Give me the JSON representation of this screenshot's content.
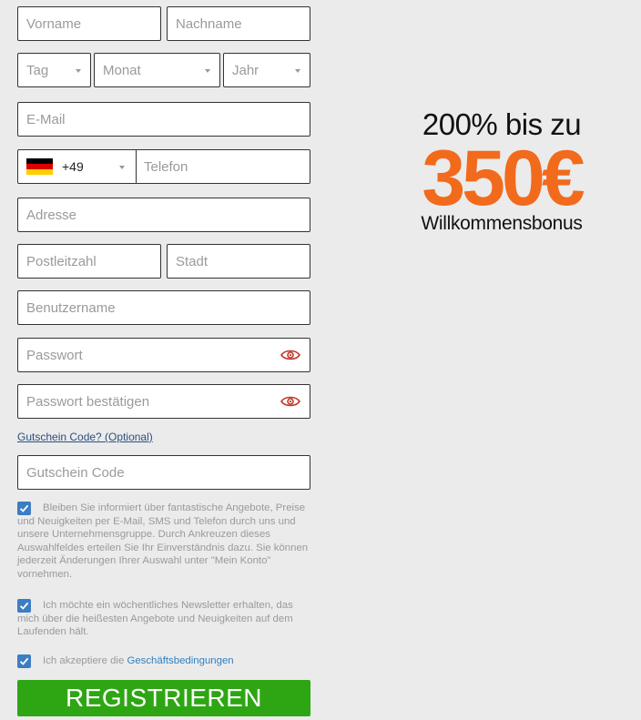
{
  "form": {
    "first_name_placeholder": "Vorname",
    "last_name_placeholder": "Nachname",
    "day_placeholder": "Tag",
    "month_placeholder": "Monat",
    "year_placeholder": "Jahr",
    "email_placeholder": "E-Mail",
    "phone_country_code": "+49",
    "phone_placeholder": "Telefon",
    "address_placeholder": "Adresse",
    "postal_placeholder": "Postleitzahl",
    "city_placeholder": "Stadt",
    "username_placeholder": "Benutzername",
    "password_placeholder": "Passwort",
    "password_confirm_placeholder": "Passwort bestätigen",
    "voucher_link": "Gutschein Code? (Optional)",
    "voucher_placeholder": "Gutschein Code",
    "consent_offers": "Bleiben Sie informiert über fantastische Angebote, Preise und Neuigkeiten per E-Mail, SMS und Telefon durch uns und unsere Unternehmensgruppe. Durch Ankreuzen dieses Auswahlfeldes erteilen Sie Ihr Einverständnis dazu. Sie können jederzeit Änderungen Ihrer Auswahl unter \"Mein Konto\" vornehmen.",
    "consent_newsletter": "Ich möchte ein wöchentliches Newsletter erhalten, das mich über die heißesten Angebote und Neuigkeiten auf dem Laufenden hält.",
    "consent_terms_prefix": "Ich akzeptiere die",
    "consent_terms_link": "Geschäftsbedingungen",
    "submit_label": "REGISTRIEREN"
  },
  "promo": {
    "line1": "200% bis zu",
    "line2": "350€",
    "line3": "Willkommensbonus"
  },
  "colors": {
    "background": "#ebebeb",
    "accent_orange": "#f26a1b",
    "submit_green": "#2ea614",
    "checkbox_blue": "#3b7ec3",
    "eye_red": "#c0392b"
  },
  "icons": {
    "flag": "germany-flag-icon",
    "eye": "eye-icon",
    "checkbox": "checkbox-checked-icon",
    "dropdown": "chevron-down-icon"
  }
}
